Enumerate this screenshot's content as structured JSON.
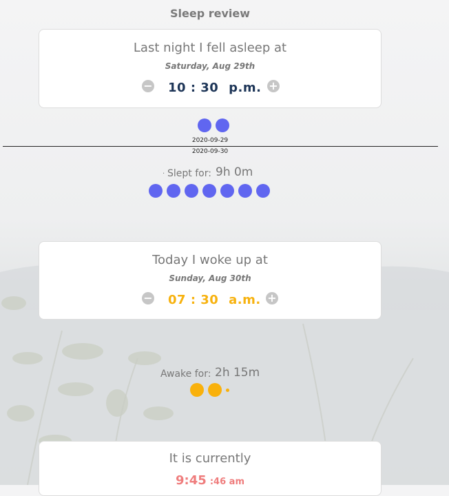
{
  "header": {
    "title": "Sleep review"
  },
  "asleep_card": {
    "heading": "Last night I fell asleep at",
    "date": "Saturday, Aug 29th",
    "time": "10 : 30",
    "ampm": "p.m.",
    "minus": "−",
    "plus": "+"
  },
  "timeline": {
    "date_before": "2020-09-29",
    "date_after": "2020-09-30"
  },
  "slept": {
    "label": "Slept for:",
    "value": "9h 0m",
    "tick": "."
  },
  "woke_card": {
    "heading": "Today I woke up at",
    "date": "Sunday, Aug 30th",
    "time": "07 : 30",
    "ampm": "a.m.",
    "minus": "−",
    "plus": "+"
  },
  "awake": {
    "label": "Awake for:",
    "value": "2h 15m"
  },
  "current_card": {
    "heading": "It is currently",
    "time": "9:45",
    "seconds": ":46 am"
  },
  "colors": {
    "sleep_dot": "#6066f0",
    "awake_dot": "#f9b10c",
    "asleep_time": "#1d3557",
    "woke_time": "#f7b20f",
    "current_time": "#ef7d7d"
  },
  "icons": {
    "minus": "minus-circle-icon",
    "plus": "plus-circle-icon"
  }
}
